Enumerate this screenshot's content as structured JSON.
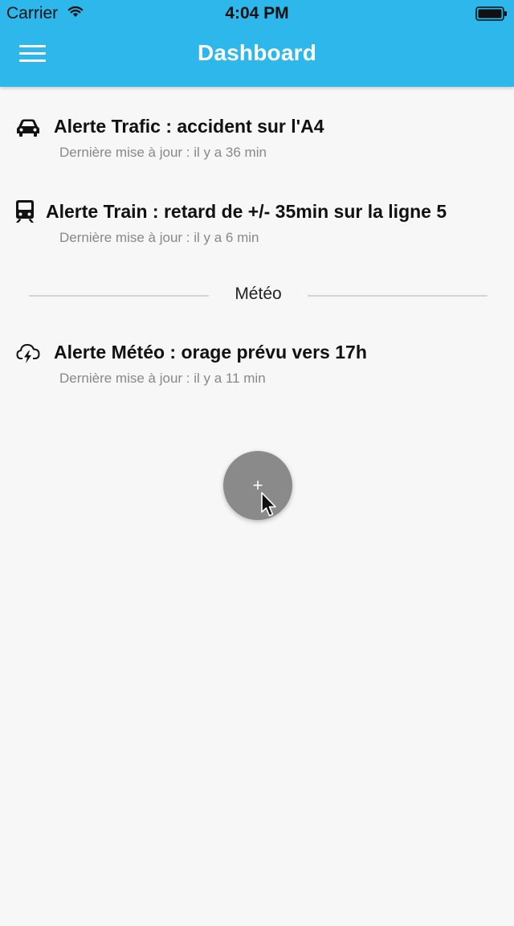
{
  "status_bar": {
    "carrier": "Carrier",
    "time": "4:04 PM"
  },
  "header": {
    "title": "Dashboard",
    "menu_icon": "hamburger-menu-icon",
    "background_color": "#2eb7ea"
  },
  "alerts": [
    {
      "icon": "car-icon",
      "title": "Alerte Trafic : accident sur l'A4",
      "updated": "Dernière mise à jour : il y a 36 min"
    },
    {
      "icon": "train-icon",
      "title": "Alerte Train : retard de +/- 35min sur la ligne 5",
      "updated": "Dernière mise à jour : il y a 6 min"
    }
  ],
  "weather_section": {
    "label": "Météo",
    "alerts": [
      {
        "icon": "storm-cloud-icon",
        "title": "Alerte Météo : orage prévu vers 17h",
        "updated": "Dernière mise à jour : il y a 11 min"
      }
    ]
  },
  "fab": {
    "label": "+",
    "icon": "plus-icon",
    "color": "#8a8a8a"
  }
}
